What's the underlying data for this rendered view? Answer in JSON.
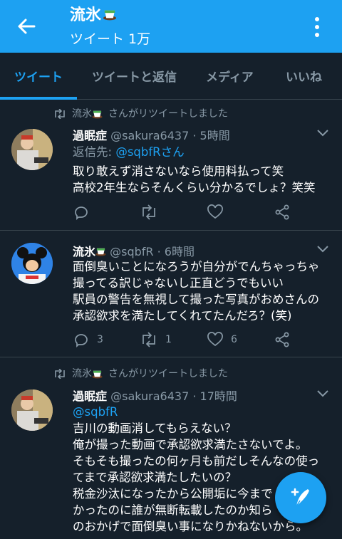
{
  "header": {
    "title": "流氷",
    "subtitle": "ツイート 1万"
  },
  "tabs": [
    {
      "label": "ツイート",
      "active": true
    },
    {
      "label": "ツイートと返信",
      "active": false
    },
    {
      "label": "メディア",
      "active": false
    },
    {
      "label": "いいね",
      "active": false
    }
  ],
  "tweets": [
    {
      "retweeted_by_name": "流氷",
      "retweeted_by_suffix": "さんがリツイートしました",
      "name": "過眠症",
      "meta": "@sakura6437 · 5時間",
      "reply_prefix": "返信先: ",
      "reply_to": "@sqbfRさん",
      "text": "取り敢えず消さないなら使用料払って笑\n高校2年生ならそんくらい分かるでしょ？笑笑",
      "reply_count": "",
      "retweet_count": "",
      "like_count": ""
    },
    {
      "name": "流氷",
      "meta": "@sqbfR · 6時間",
      "text": "面倒臭いことになろうが自分がでんちゃっちゃ\n撮ってる訳じゃないし正直どうでもいい\n駅員の警告を無視して撮った写真がおめさんの\n承認欲求を満たしてくれてたんだろ？(笑)",
      "reply_count": "3",
      "retweet_count": "1",
      "like_count": "6"
    },
    {
      "retweeted_by_name": "流氷",
      "retweeted_by_suffix": "さんがリツイートしました",
      "name": "過眠症",
      "meta": "@sakura6437 · 17時間",
      "mention": "@sqbfR",
      "text": "吉川の動画消してもらえない？\n俺が撮った動画で承認欲求満たさないでよ。\nそもそも撮ったの何ヶ月も前だしそんなの使っ\nてまで承認欲求満たしたいの？\n税金沙汰になったから公開垢に今まで\nかったのに誰が無断転載したのか知ら\nのおかげで面倒臭い事になりかねないから。"
    }
  ],
  "colors": {
    "accent": "#1da1f2",
    "background": "#15202b",
    "muted": "#8899a6",
    "divider": "#38444d"
  },
  "icons": [
    "back-arrow-icon",
    "kebab-menu-icon",
    "retweet-icon",
    "chevron-down-icon",
    "reply-icon",
    "like-icon",
    "share-icon",
    "compose-icon",
    "tea-emoji-icon"
  ]
}
